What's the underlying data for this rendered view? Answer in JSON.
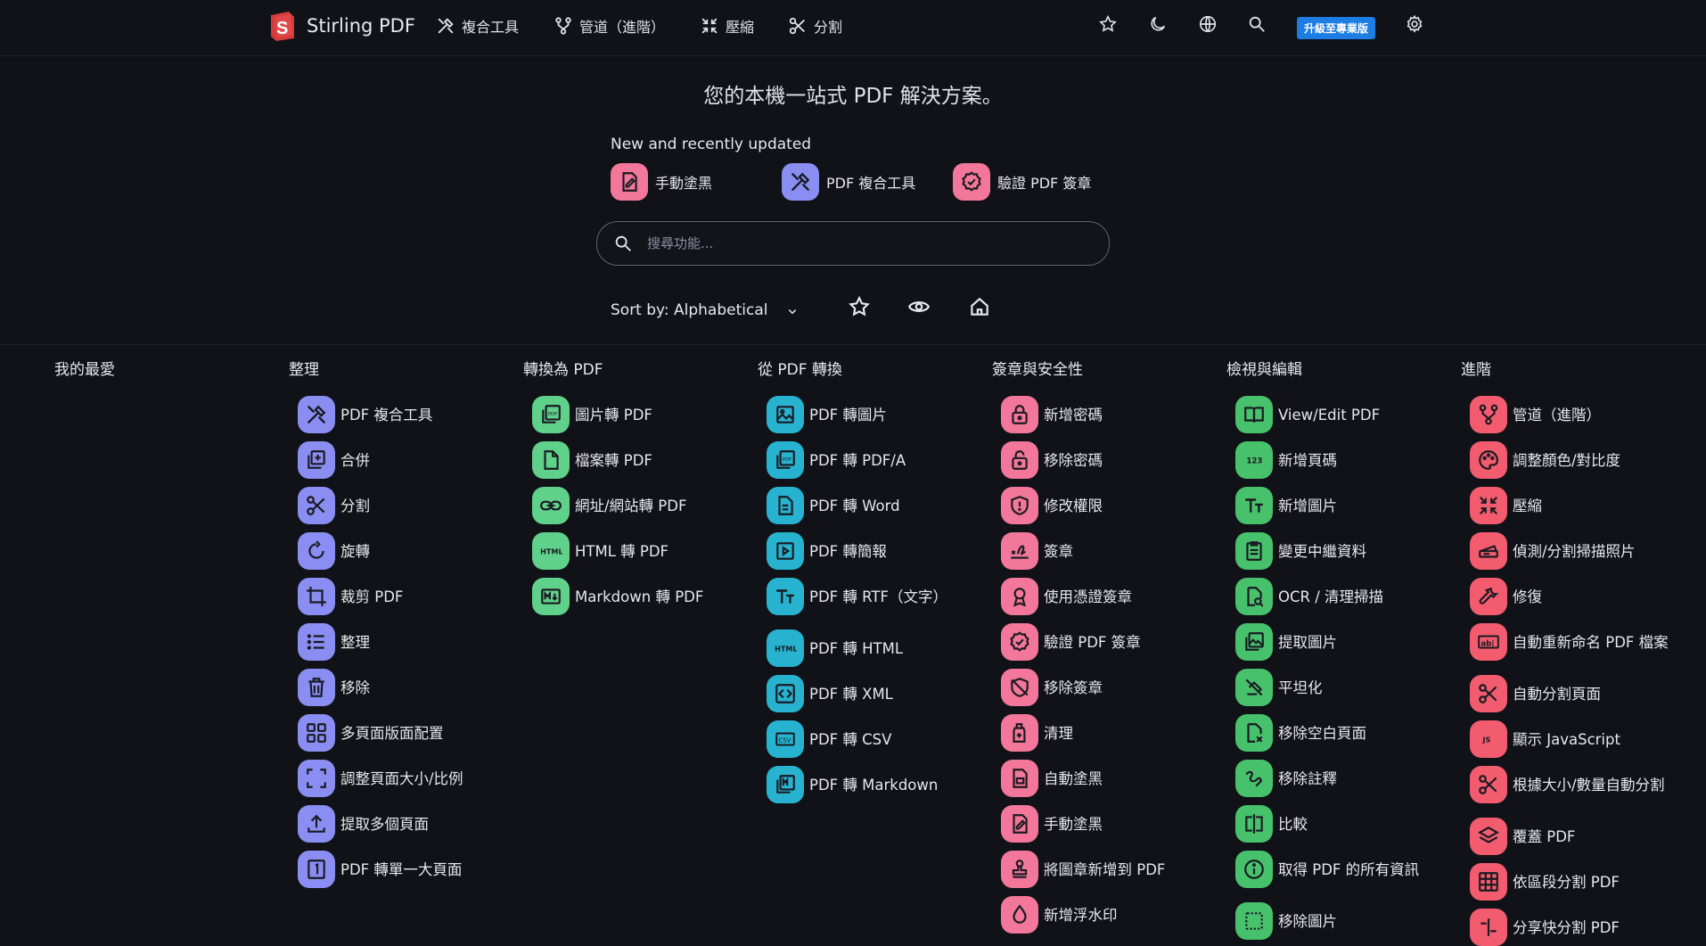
{
  "app": {
    "brand": "Stirling PDF",
    "nav": [
      {
        "label": "複合工具",
        "icon": "tools-icon"
      },
      {
        "label": "管道（進階）",
        "icon": "pipeline-icon"
      },
      {
        "label": "壓縮",
        "icon": "compress-icon"
      },
      {
        "label": "分割",
        "icon": "scissors-icon"
      }
    ],
    "upgrade_label": "升級至專業版"
  },
  "hero": {
    "title": "您的本機一站式 PDF 解決方案。",
    "recent_title": "New and recently updated",
    "recent": [
      {
        "label": "手動塗黑",
        "icon": "redact-icon"
      },
      {
        "label": "PDF 複合工具",
        "icon": "tools-icon"
      },
      {
        "label": "驗證 PDF 簽章",
        "icon": "verify-badge-icon"
      }
    ],
    "search_placeholder": "搜尋功能...",
    "sort_label": "Sort by: Alphabetical"
  },
  "colors": {
    "organize": "#8a8ef2",
    "convert_to": "#5fd18b",
    "convert_from": "#27b3cf",
    "security": "#f2779a",
    "view_edit": "#47c16b",
    "advanced": "#f25c6e",
    "upgrade": "#1d7de3"
  },
  "columns": [
    {
      "title": "我的最愛",
      "items": []
    },
    {
      "title": "整理",
      "items": [
        {
          "label": "PDF 複合工具",
          "icon": "tools-icon"
        },
        {
          "label": "合併",
          "icon": "merge-icon"
        },
        {
          "label": "分割",
          "icon": "scissors-icon"
        },
        {
          "label": "旋轉",
          "icon": "rotate-icon"
        },
        {
          "label": "裁剪 PDF",
          "icon": "crop-icon"
        },
        {
          "label": "整理",
          "icon": "list-icon"
        },
        {
          "label": "移除",
          "icon": "trash-icon"
        },
        {
          "label": "多頁面版面配置",
          "icon": "grid-icon"
        },
        {
          "label": "調整頁面大小/比例",
          "icon": "resize-icon"
        },
        {
          "label": "提取多個頁面",
          "icon": "upload-icon"
        },
        {
          "label": "PDF 轉單一大頁面",
          "icon": "single-page-icon"
        }
      ]
    },
    {
      "title": "轉換為 PDF",
      "items": [
        {
          "label": "圖片轉 PDF",
          "icon": "image-to-pdf-icon"
        },
        {
          "label": "檔案轉 PDF",
          "icon": "file-icon"
        },
        {
          "label": "網址/網站轉 PDF",
          "icon": "link-icon"
        },
        {
          "label": "HTML 轉 PDF",
          "icon": "html-icon"
        },
        {
          "label": "Markdown 轉 PDF",
          "icon": "markdown-icon"
        }
      ]
    },
    {
      "title": "從 PDF 轉換",
      "items": [
        {
          "label": "PDF 轉圖片",
          "icon": "image-icon"
        },
        {
          "label": "PDF 轉 PDF/A",
          "icon": "pdfa-icon"
        },
        {
          "label": "PDF 轉 Word",
          "icon": "word-icon"
        },
        {
          "label": "PDF 轉簡報",
          "icon": "slides-icon"
        },
        {
          "label": "PDF 轉 RTF（文字）",
          "icon": "text-icon"
        },
        {
          "label": "PDF 轉 HTML",
          "icon": "html-icon"
        },
        {
          "label": "PDF 轉 XML",
          "icon": "code-icon"
        },
        {
          "label": "PDF 轉 CSV",
          "icon": "csv-icon"
        },
        {
          "label": "PDF 轉 Markdown",
          "icon": "markdown-icon"
        }
      ]
    },
    {
      "title": "簽章與安全性",
      "items": [
        {
          "label": "新增密碼",
          "icon": "lock-icon"
        },
        {
          "label": "移除密碼",
          "icon": "unlock-icon"
        },
        {
          "label": "修改權限",
          "icon": "shield-icon"
        },
        {
          "label": "簽章",
          "icon": "signature-icon"
        },
        {
          "label": "使用憑證簽章",
          "icon": "certificate-icon"
        },
        {
          "label": "驗證 PDF 簽章",
          "icon": "verify-badge-icon"
        },
        {
          "label": "移除簽章",
          "icon": "shield-off-icon"
        },
        {
          "label": "清理",
          "icon": "sanitize-icon"
        },
        {
          "label": "自動塗黑",
          "icon": "auto-redact-icon"
        },
        {
          "label": "手動塗黑",
          "icon": "redact-icon"
        },
        {
          "label": "將圖章新增到 PDF",
          "icon": "stamp-icon"
        },
        {
          "label": "新增浮水印",
          "icon": "watermark-icon"
        }
      ]
    },
    {
      "title": "檢視與編輯",
      "items": [
        {
          "label": "View/Edit PDF",
          "icon": "book-icon"
        },
        {
          "label": "新增頁碼",
          "icon": "page-numbers-icon"
        },
        {
          "label": "新增圖片",
          "icon": "text-icon"
        },
        {
          "label": "變更中繼資料",
          "icon": "clipboard-icon"
        },
        {
          "label": "OCR / 清理掃描",
          "icon": "ocr-icon"
        },
        {
          "label": "提取圖片",
          "icon": "image-icon"
        },
        {
          "label": "平坦化",
          "icon": "flatten-icon"
        },
        {
          "label": "移除空白頁面",
          "icon": "blank-page-icon"
        },
        {
          "label": "移除註釋",
          "icon": "annotation-icon"
        },
        {
          "label": "比較",
          "icon": "compare-icon"
        },
        {
          "label": "取得 PDF 的所有資訊",
          "icon": "info-icon"
        },
        {
          "label": "移除圖片",
          "icon": "remove-image-icon"
        }
      ]
    },
    {
      "title": "進階",
      "items": [
        {
          "label": "管道（進階）",
          "icon": "pipeline-icon"
        },
        {
          "label": "調整顏色/對比度",
          "icon": "palette-icon"
        },
        {
          "label": "壓縮",
          "icon": "compress-icon"
        },
        {
          "label": "偵測/分割掃描照片",
          "icon": "scanner-icon"
        },
        {
          "label": "修復",
          "icon": "wrench-icon"
        },
        {
          "label": "自動重新命名 PDF 檔案",
          "icon": "rename-icon"
        },
        {
          "label": "自動分割頁面",
          "icon": "scissors-icon"
        },
        {
          "label": "顯示 JavaScript",
          "icon": "javascript-icon"
        },
        {
          "label": "根據大小/數量自動分割",
          "icon": "scissors-icon"
        },
        {
          "label": "覆蓋 PDF",
          "icon": "layers-icon"
        },
        {
          "label": "依區段分割 PDF",
          "icon": "grid-icon"
        },
        {
          "label": "分享快分割 PDF",
          "icon": "split-icon"
        }
      ]
    }
  ]
}
